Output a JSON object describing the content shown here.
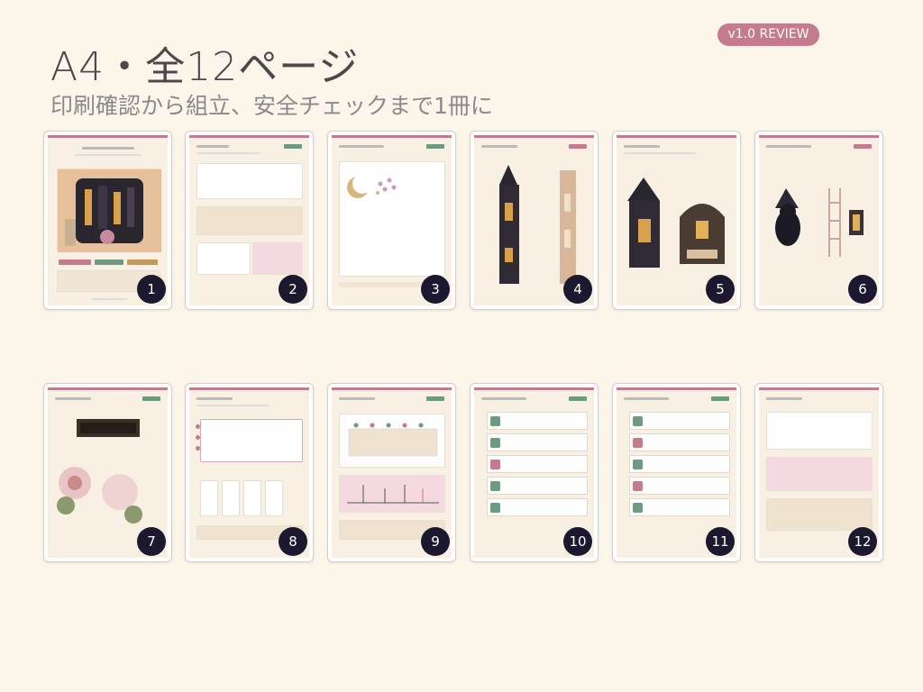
{
  "header": {
    "title": "A4・全12ページ",
    "subtitle": "印刷確認から組立、安全チェックまで1冊に",
    "badge": "v1.0 REVIEW"
  },
  "colors": {
    "background": "#fbf5ea",
    "accent_pink": "#c47b8e",
    "accent_green": "#6f9a82",
    "number_circle": "#1b1830"
  },
  "pages": [
    {
      "number": "1"
    },
    {
      "number": "2"
    },
    {
      "number": "3"
    },
    {
      "number": "4"
    },
    {
      "number": "5"
    },
    {
      "number": "6"
    },
    {
      "number": "7"
    },
    {
      "number": "8"
    },
    {
      "number": "9"
    },
    {
      "number": "10"
    },
    {
      "number": "11"
    },
    {
      "number": "12"
    }
  ]
}
